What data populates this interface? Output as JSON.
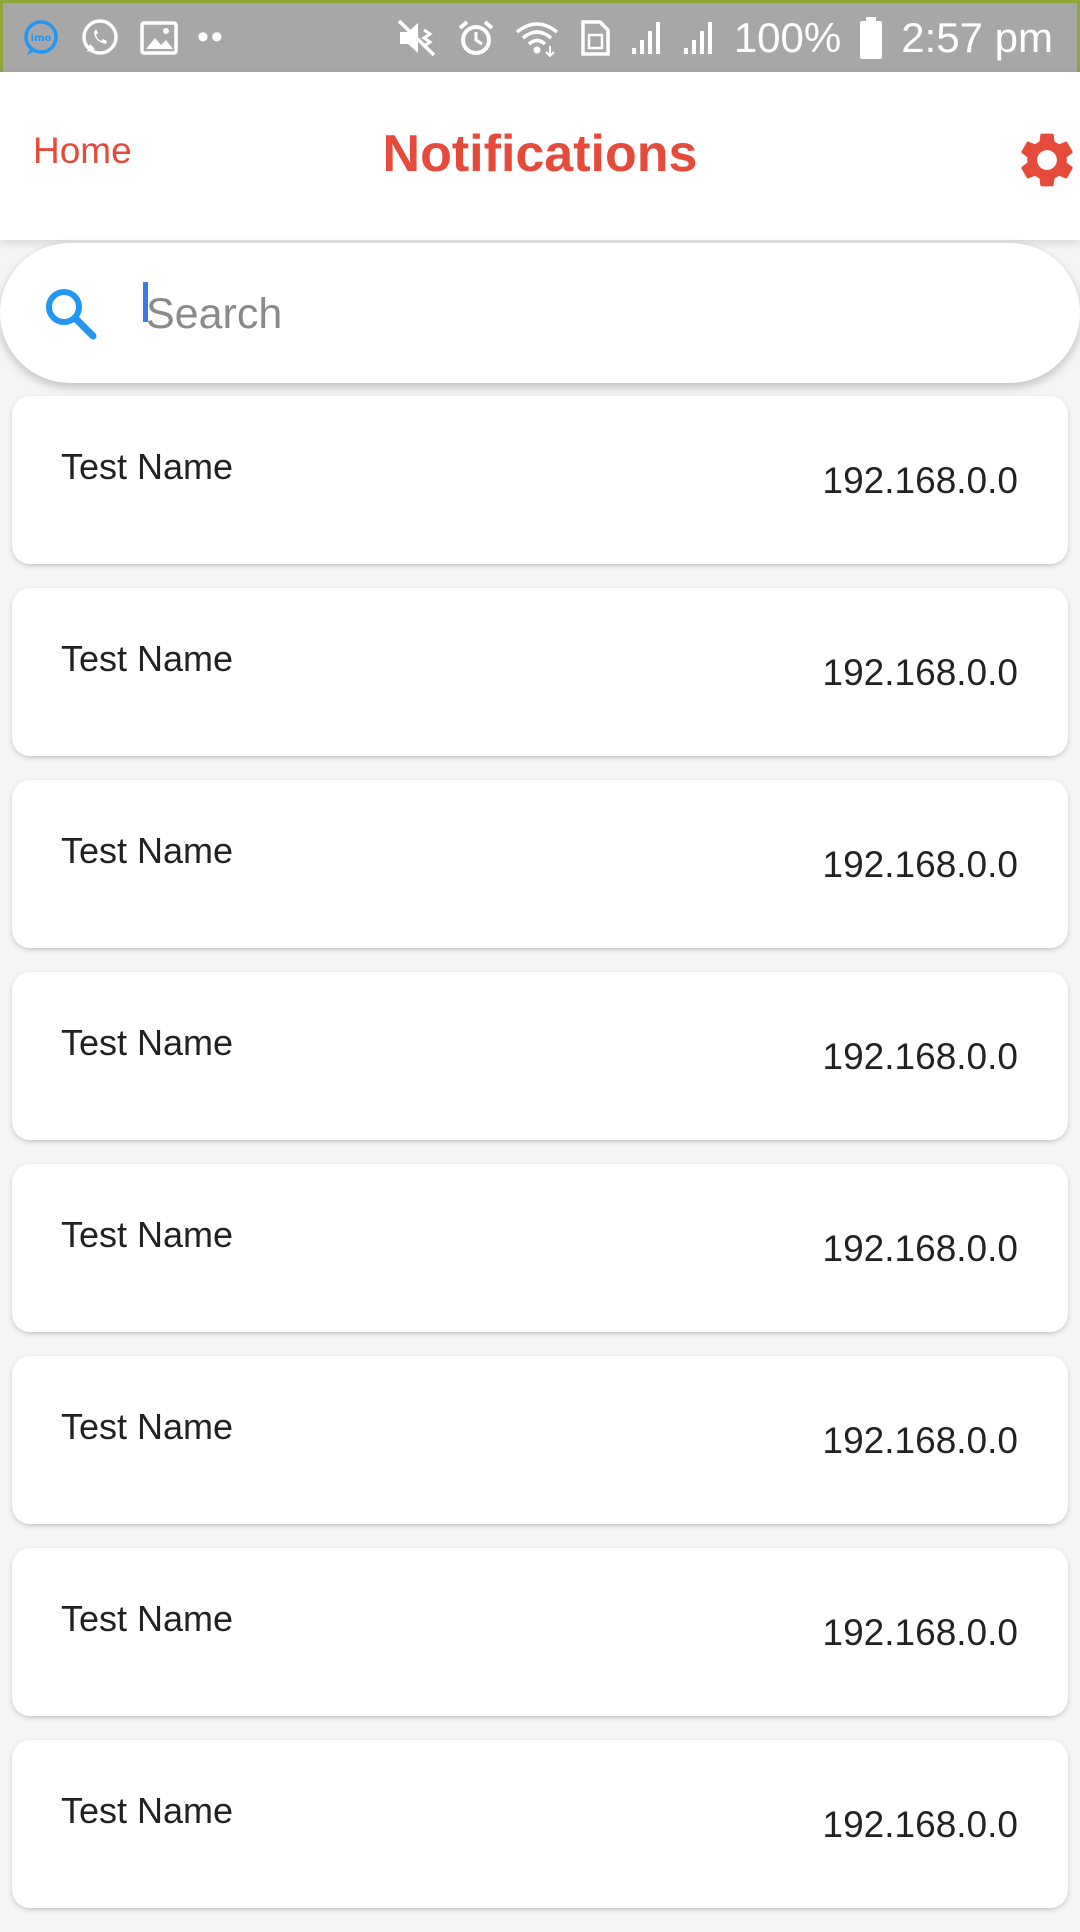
{
  "status_bar": {
    "battery": "100%",
    "time": "2:57 pm",
    "left_icons": [
      "imo-icon",
      "whatsapp-icon",
      "gallery-icon",
      "more-dots-icon"
    ],
    "right_icons": [
      "vibrate-icon",
      "alarm-icon",
      "wifi-icon",
      "sim-icon",
      "signal-icon",
      "signal-icon",
      "battery-icon"
    ]
  },
  "app_bar": {
    "home_label": "Home",
    "title": "Notifications",
    "settings_icon": "gear-icon"
  },
  "search": {
    "placeholder": "Search",
    "value": ""
  },
  "items": [
    {
      "name": "Test Name",
      "ip": "192.168.0.0"
    },
    {
      "name": "Test Name",
      "ip": "192.168.0.0"
    },
    {
      "name": "Test Name",
      "ip": "192.168.0.0"
    },
    {
      "name": "Test Name",
      "ip": "192.168.0.0"
    },
    {
      "name": "Test Name",
      "ip": "192.168.0.0"
    },
    {
      "name": "Test Name",
      "ip": "192.168.0.0"
    },
    {
      "name": "Test Name",
      "ip": "192.168.0.0"
    },
    {
      "name": "Test Name",
      "ip": "192.168.0.0"
    }
  ],
  "colors": {
    "accent": "#e64a3b",
    "search_icon": "#2196f3",
    "status_bar": "#a7a7a7"
  }
}
